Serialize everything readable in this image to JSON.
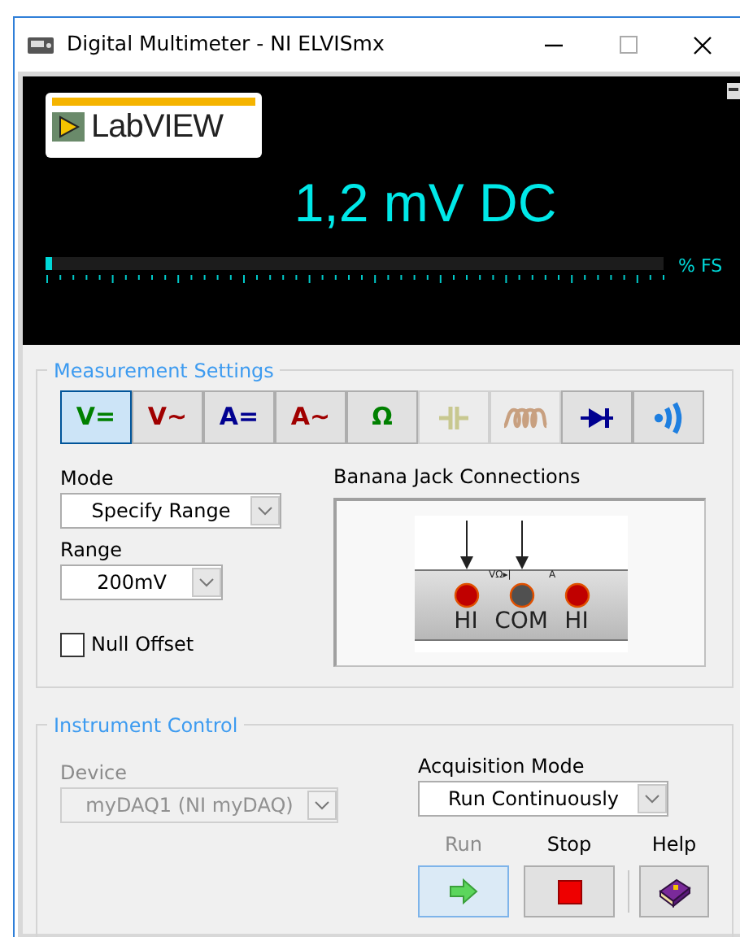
{
  "window": {
    "title": "Digital Multimeter - NI ELVISmx"
  },
  "display": {
    "logo_text": "LabVIEW",
    "reading": "1,2 mV DC",
    "level": 0.01,
    "scale_label": "% FS"
  },
  "measurement_settings": {
    "title": "Measurement Settings",
    "functions": [
      {
        "kind": "text",
        "label": "V=",
        "color": "#008000",
        "selected": true,
        "disabled": false
      },
      {
        "kind": "text",
        "label": "V~",
        "color": "#a00000",
        "selected": false,
        "disabled": false
      },
      {
        "kind": "text",
        "label": "A=",
        "color": "#000090",
        "selected": false,
        "disabled": false
      },
      {
        "kind": "text",
        "label": "A~",
        "color": "#a00000",
        "selected": false,
        "disabled": false
      },
      {
        "kind": "text",
        "label": "Ω",
        "color": "#008000",
        "selected": false,
        "disabled": false
      },
      {
        "kind": "capacitor",
        "color": "#c8c890",
        "selected": false,
        "disabled": true
      },
      {
        "kind": "inductor",
        "color": "#c8a080",
        "selected": false,
        "disabled": true
      },
      {
        "kind": "diode",
        "color": "#000090",
        "selected": false,
        "disabled": false
      },
      {
        "kind": "sound",
        "color": "#1e7fe0",
        "selected": false,
        "disabled": false
      }
    ],
    "mode": {
      "label": "Mode",
      "value": "Specify Range"
    },
    "range": {
      "label": "Range",
      "value": "200mV"
    },
    "null_offset": {
      "label": "Null Offset",
      "checked": false
    },
    "banana_jacks": {
      "title": "Banana Jack Connections",
      "marks": [
        "VΩ▸|",
        "A"
      ],
      "terminals": [
        {
          "label": "HI",
          "color": "#c00000",
          "probe": true
        },
        {
          "label": "COM",
          "color": "#505050",
          "probe": true
        },
        {
          "label": "HI",
          "color": "#c00000",
          "probe": false
        }
      ]
    }
  },
  "instrument_control": {
    "title": "Instrument Control",
    "device": {
      "label": "Device",
      "value": "myDAQ1 (NI myDAQ)",
      "disabled": true
    },
    "acquisition_mode": {
      "label": "Acquisition Mode",
      "value": "Run Continuously"
    },
    "buttons": [
      {
        "kind": "run",
        "label": "Run",
        "pressed": true
      },
      {
        "kind": "stop",
        "label": "Stop",
        "pressed": false
      },
      {
        "kind": "help",
        "label": "Help",
        "pressed": false
      }
    ]
  }
}
